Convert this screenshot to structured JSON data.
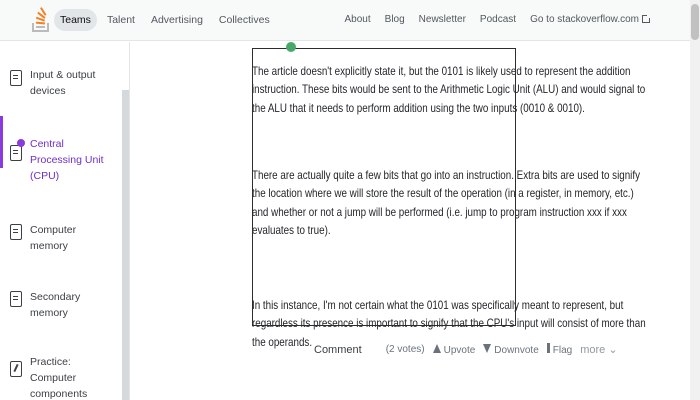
{
  "topnav": {
    "left_tabs": [
      {
        "label": "Teams",
        "active": true
      },
      {
        "label": "Talent",
        "active": false
      },
      {
        "label": "Advertising",
        "active": false
      },
      {
        "label": "Collectives",
        "active": false
      }
    ],
    "right_links": [
      "About",
      "Blog",
      "Newsletter",
      "Podcast",
      "Go to stackoverflow.com"
    ],
    "logo_icon": "stackoverflow-logo-icon",
    "external_icon": "external-link-icon"
  },
  "sidebar": {
    "items": [
      {
        "label": "Input & output devices",
        "icon": "document-icon",
        "active": false
      },
      {
        "label": "Central Processing Unit (CPU)",
        "icon": "document-icon",
        "active": true
      },
      {
        "label": "Computer memory",
        "icon": "document-icon",
        "active": false
      },
      {
        "label": "Secondary memory",
        "icon": "document-icon",
        "active": false
      },
      {
        "label": "Practice: Computer components",
        "icon": "pencil-icon",
        "active": false
      }
    ],
    "accent_color": "#8a3bdf"
  },
  "content": {
    "paragraphs": [
      [
        "The article doesn't explicitly state it, but the 0101 is likely used to represent the addition",
        "instruction. These bits would be sent to the Arithmetic Logic Unit (ALU) and would signal to",
        "the ALU that it needs to perform addition using the two inputs (0010 & 0010)."
      ],
      [
        "There are actually quite a few bits that go into an instruction. Extra bits are used to signify",
        "the location where we will store the result of the operation (in a register, in memory, etc.)",
        "and whether or not a jump will be performed (i.e. jump to program instruction xxx if xxx",
        "evaluates to true)."
      ],
      [
        "In this instance, I'm not certain what the 0101 was specifically meant to represent, but",
        "regardless its presence is important to signify that the CPU's input will consist of more than",
        "the operands."
      ]
    ]
  },
  "actions": {
    "comment": "Comment",
    "votes": "(2 votes)",
    "upvote": "Upvote",
    "downvote": "Downvote",
    "flag": "Flag",
    "more": "more"
  }
}
